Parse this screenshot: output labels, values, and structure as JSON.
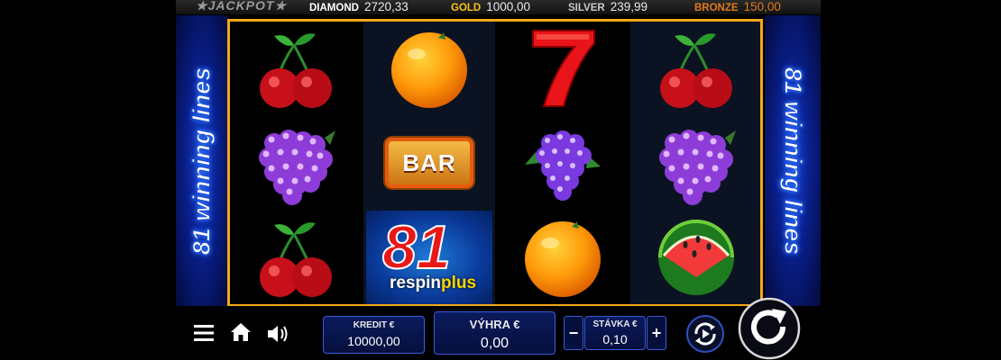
{
  "jackpot": {
    "logo": "JACKPOT",
    "diamond_label": "DIAMOND",
    "diamond_value": "2720,33",
    "gold_label": "GOLD",
    "gold_value": "1000,00",
    "silver_label": "SILVER",
    "silver_value": "239,99",
    "bronze_label": "BRONZE",
    "bronze_value": "150,00",
    "colors": {
      "diamond": "#ffffff",
      "gold": "#f5c518",
      "silver": "#c9c9c9",
      "bronze": "#e07a1c"
    }
  },
  "side_text": "81 winning lines",
  "reels": [
    [
      "cherry",
      "grapes",
      "cherry"
    ],
    [
      "orange",
      "bar",
      "respin-plus-81"
    ],
    [
      "seven",
      "grapes",
      "orange"
    ],
    [
      "cherry",
      "grapes",
      "watermelon"
    ]
  ],
  "symbols": {
    "bar_text": "BAR",
    "respin_number": "81",
    "respin_word1": "respin",
    "respin_word2": "plus"
  },
  "bottom": {
    "credit_label": "KREDIT €",
    "credit_value": "10000,00",
    "win_label": "VÝHRA €",
    "win_value": "0,00",
    "bet_label": "STÁVKA €",
    "bet_value": "0,10",
    "minus": "−",
    "plus": "+"
  },
  "icons": [
    "menu-icon",
    "home-icon",
    "sound-icon",
    "autoplay-icon",
    "spin-icon"
  ]
}
